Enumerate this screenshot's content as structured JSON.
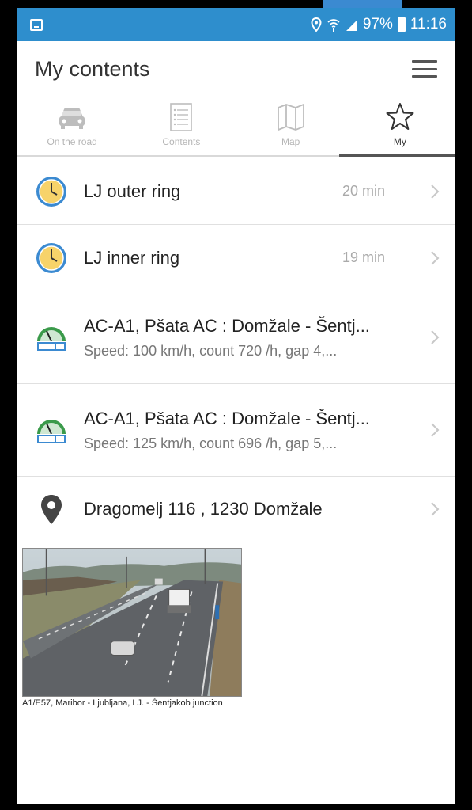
{
  "status_bar": {
    "battery": "97%",
    "time": "11:16",
    "icons": [
      "screenshot-icon",
      "location-pin-icon",
      "wifi-icon",
      "signal-icon",
      "battery-icon"
    ]
  },
  "header": {
    "title": "My contents",
    "menu_icon": "hamburger-menu-icon"
  },
  "tabs": [
    {
      "label": "On the road",
      "icon": "car-icon",
      "active": false
    },
    {
      "label": "Contents",
      "icon": "list-icon",
      "active": false
    },
    {
      "label": "Map",
      "icon": "map-icon",
      "active": false
    },
    {
      "label": "My",
      "icon": "star-icon",
      "active": true
    }
  ],
  "items": [
    {
      "title": "LJ outer ring",
      "time": "20 min",
      "icon": "travel-time-clock-icon"
    },
    {
      "title": "LJ inner ring",
      "time": "19 min",
      "icon": "travel-time-clock-icon"
    },
    {
      "title": "AC-A1, Pšata AC : Domžale - Šentj...",
      "subtitle": "Speed: 100 km/h, count 720 /h, gap 4,...",
      "icon": "traffic-counter-icon"
    },
    {
      "title": "AC-A1, Pšata AC : Domžale - Šentj...",
      "subtitle": "Speed: 125 km/h, count 696 /h, gap 5,...",
      "icon": "traffic-counter-icon"
    },
    {
      "title": "Dragomelj 116 , 1230 Domžale",
      "icon": "location-pin-icon"
    }
  ],
  "camera": {
    "caption": "A1/E57, Maribor - Ljubljana, LJ. - Šentjakob junction"
  },
  "colors": {
    "status_bar": "#2e8ecd",
    "clock_blue": "#3b8ad1",
    "clock_yellow": "#f7d36a",
    "counter_green": "#3a9a4a"
  }
}
